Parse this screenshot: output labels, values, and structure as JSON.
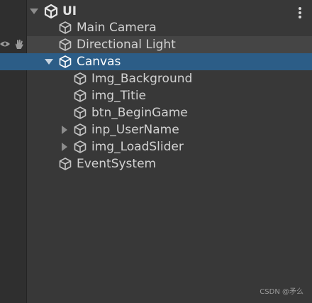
{
  "hierarchy": {
    "root": {
      "name": "UI",
      "icon": "unity-logo-icon"
    },
    "items": [
      {
        "label": "Main Camera",
        "icon": "gameobject-cube-icon"
      },
      {
        "label": "Directional Light",
        "icon": "gameobject-cube-icon"
      },
      {
        "label": "Canvas",
        "icon": "gameobject-cube-icon",
        "expanded": true,
        "selected": true
      },
      {
        "label": "Img_Background",
        "icon": "gameobject-cube-icon"
      },
      {
        "label": "img_Titie",
        "icon": "gameobject-cube-icon"
      },
      {
        "label": "btn_BeginGame",
        "icon": "gameobject-cube-icon"
      },
      {
        "label": "inp_UserName",
        "icon": "gameobject-cube-icon",
        "collapsed": true
      },
      {
        "label": "img_LoadSlider",
        "icon": "gameobject-cube-icon",
        "collapsed": true
      },
      {
        "label": "EventSystem",
        "icon": "gameobject-cube-icon"
      }
    ]
  },
  "watermark": "CSDN @矛么",
  "colors": {
    "background": "#383838",
    "selection": "#2c5d87",
    "hover": "#454545",
    "text": "#d2d2d2"
  }
}
